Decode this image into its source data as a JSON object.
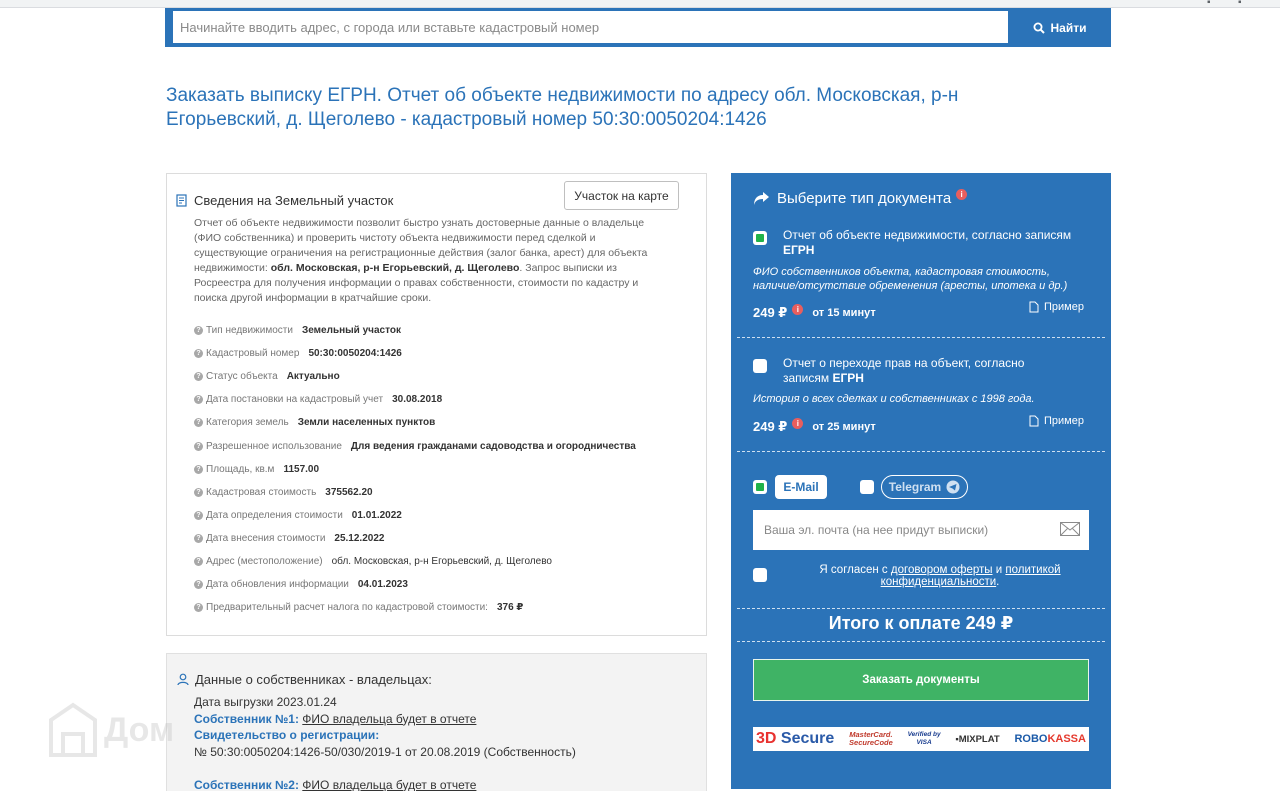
{
  "search": {
    "placeholder": "Начинайте вводить адрес, с города или вставьте кадастровый номер",
    "button_label": "Найти"
  },
  "page_title": "Заказать выписку ЕГРН. Отчет об объекте недвижимости по адресу обл. Московская, р-н Егорьевский, д. Щеголево - кадастровый номер 50:30:0050204:1426",
  "land_card": {
    "title": "Сведения на Земельный участок",
    "map_button": "Участок на карте",
    "desc_1": "Отчет об объекте недвижимости позволит быстро узнать достоверные данные о владельце (ФИО собственника) и проверить чистоту объекта недвижимости перед сделкой и существующие ограничения на регистрационные действия (залог банка, арест) для объекта недвижимости: ",
    "desc_address": "обл. Московская, р-н Егорьевский, д. Щеголево",
    "desc_2": ". Запрос выписки из Росреестра для получения информации о правах собственности, стоимости по кадастру и поиска другой информации в кратчайшие сроки.",
    "properties": [
      {
        "label": "Тип недвижимости",
        "value": "Земельный участок"
      },
      {
        "label": "Кадастровый номер",
        "value": "50:30:0050204:1426"
      },
      {
        "label": "Статус объекта",
        "value": "Актуально"
      },
      {
        "label": "Дата постановки на кадастровый учет",
        "value": "30.08.2018"
      },
      {
        "label": "Категория земель",
        "value": "Земли населенных пунктов"
      },
      {
        "label": "Разрешенное использование",
        "value": "Для ведения гражданами садоводства и огородничества"
      },
      {
        "label": "Площадь, кв.м",
        "value": "1157.00"
      },
      {
        "label": "Кадастровая стоимость",
        "value": "375562.20"
      },
      {
        "label": "Дата определения стоимости",
        "value": "01.01.2022"
      },
      {
        "label": "Дата внесения стоимости",
        "value": "25.12.2022"
      },
      {
        "label": "Адрес (местоположение)",
        "value": "обл. Московская, р-н Егорьевский, д. Щеголево"
      },
      {
        "label": "Дата обновления информации",
        "value": "04.01.2023"
      },
      {
        "label": "Предварительный расчет налога по кадастровой стоимости:",
        "value": "376 ₽"
      }
    ]
  },
  "owners": {
    "title": "Данные о собственниках - владельцах:",
    "export_date": "Дата выгрузки 2023.01.24",
    "owner1_label": "Собственник №1:",
    "owner1_value": "ФИО владельца будет в отчете",
    "cert_label": "Свидетельство о регистрации:",
    "cert_value": "№ 50:30:0050204:1426-50/030/2019-1 от 20.08.2019 (Собственность)",
    "owner2_label": "Собственник №2:",
    "owner2_value": "ФИО владельца будет в отчете"
  },
  "watermark": "Дом",
  "order": {
    "title": "Выберите тип документа",
    "doc1": {
      "title_1": "Отчет об объекте недвижимости, согласно записям ",
      "title_2": "ЕГРН",
      "desc": "ФИО собственников объекта, кадастровая стоимость, наличие/отсутствие обременения (аресты, ипотека и др.)",
      "price": "249 ₽",
      "term": "от 15 минут",
      "example": "Пример",
      "checked": true
    },
    "doc2": {
      "title_1": "Отчет о переходе прав на объект, согласно записям ",
      "title_2": "ЕГРН",
      "desc": "История о всех сделках и собственниках с 1998 года.",
      "price": "249 ₽",
      "term": "от 25 минут",
      "example": "Пример",
      "checked": false
    },
    "channel_email": "E-Mail",
    "channel_telegram": "Telegram",
    "email_placeholder": "Ваша эл. почта (на нее придут выписки)",
    "agree_1": "Я согласен с ",
    "agree_offer": "договором оферты",
    "agree_and": " и ",
    "agree_policy": "политикой конфиденциальности",
    "agree_end": ".",
    "total": "Итого к оплате 249 ₽",
    "submit": "Заказать документы",
    "payments": {
      "secure_3d": "3D",
      "secure_word": "Secure",
      "mc_1": "MasterCard.",
      "mc_2": "SecureCode",
      "visa_1": "Verified by",
      "visa_2": "VISA",
      "mixplat": "MIXPLAT",
      "robo_1": "ROBO",
      "robo_2": "KASSA"
    }
  },
  "colors": {
    "brand_blue": "#2b73b8",
    "green": "#3fb365",
    "check_green": "#21b24a",
    "info_red": "#e85e5e"
  }
}
